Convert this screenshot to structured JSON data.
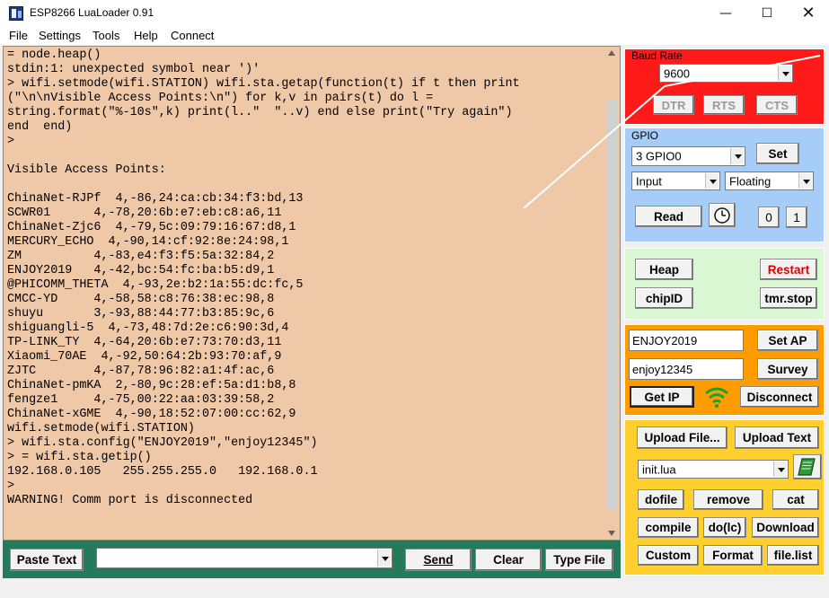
{
  "window": {
    "title": "ESP8266 LuaLoader 0.91"
  },
  "menu": [
    "File",
    "Settings",
    "Tools",
    "Help",
    "Connect"
  ],
  "terminal": {
    "lines": [
      "= node.heap()",
      "stdin:1: unexpected symbol near ')'",
      "> wifi.setmode(wifi.STATION) wifi.sta.getap(function(t) if t then print",
      "(\"\\n\\nVisible Access Points:\\n\") for k,v in pairs(t) do l =",
      "string.format(\"%-10s\",k) print(l..\"  \"..v) end else print(\"Try again\")",
      "end  end)",
      ">",
      "",
      "Visible Access Points:",
      "",
      "ChinaNet-RJPf  4,-86,24:ca:cb:34:f3:bd,13",
      "SCWR01      4,-78,20:6b:e7:eb:c8:a6,11",
      "ChinaNet-Zjc6  4,-79,5c:09:79:16:67:d8,1",
      "MERCURY_ECHO  4,-90,14:cf:92:8e:24:98,1",
      "ZM          4,-83,e4:f3:f5:5a:32:84,2",
      "ENJOY2019   4,-42,bc:54:fc:ba:b5:d9,1",
      "@PHICOMM_THETA  4,-93,2e:b2:1a:55:dc:fc,5",
      "CMCC-YD     4,-58,58:c8:76:38:ec:98,8",
      "shuyu       3,-93,88:44:77:b3:85:9c,6",
      "shiguangli-5  4,-73,48:7d:2e:c6:90:3d,4",
      "TP-LINK_TY  4,-64,20:6b:e7:73:70:d3,11",
      "Xiaomi_70AE  4,-92,50:64:2b:93:70:af,9",
      "ZJTC        4,-87,78:96:82:a1:4f:ac,6",
      "ChinaNet-pmKA  2,-80,9c:28:ef:5a:d1:b8,8",
      "fengze1     4,-75,00:22:aa:03:39:58,2",
      "ChinaNet-xGME  4,-90,18:52:07:00:cc:62,9",
      "wifi.setmode(wifi.STATION)",
      "> wifi.sta.config(\"ENJOY2019\",\"enjoy12345\")",
      "> = wifi.sta.getip()",
      "192.168.0.105   255.255.255.0   192.168.0.1",
      ">",
      "WARNING! Comm port is disconnected"
    ]
  },
  "bottom": {
    "paste_text": "Paste Text",
    "send_input_value": "",
    "send": "Send",
    "clear": "Clear",
    "type_file": "Type File"
  },
  "baud": {
    "legend": "Baud Rate",
    "value": "9600",
    "dtr": "DTR",
    "rts": "RTS",
    "cts": "CTS"
  },
  "gpio": {
    "legend": "GPIO",
    "pin": "3 GPIO0",
    "set": "Set",
    "mode": "Input",
    "pull": "Floating",
    "read": "Read",
    "zero": "0",
    "one": "1"
  },
  "system": {
    "heap": "Heap",
    "restart": "Restart",
    "chipid": "chipID",
    "tmrstop": "tmr.stop"
  },
  "network": {
    "ssid": "ENJOY2019",
    "password": "enjoy12345",
    "set_ap": "Set AP",
    "survey": "Survey",
    "get_ip": "Get IP",
    "disconnect": "Disconnect"
  },
  "files": {
    "upload_file": "Upload File...",
    "upload_text": "Upload Text",
    "file_name": "init.lua",
    "dofile": "dofile",
    "remove": "remove",
    "cat": "cat",
    "compile": "compile",
    "do_lc": "do(lc)",
    "download": "Download",
    "custom": "Custom",
    "format": "Format",
    "file_list": "file.list"
  },
  "colors": {
    "terminal_bg": "#efc8a8",
    "bottombar_bg": "#257a5b",
    "baud_panel": "#ff1a1a",
    "gpio_panel": "#a6cdf7",
    "system_panel": "#d9f7d3",
    "network_panel": "#ff9d00",
    "file_panel": "#ffcf2e",
    "restart_text": "#e00000",
    "wifi_icon": "#1aa32a"
  },
  "icons": {
    "app": "app-icon",
    "wifi": "wifi-icon",
    "book": "book-icon",
    "clock": "clock-icon"
  }
}
